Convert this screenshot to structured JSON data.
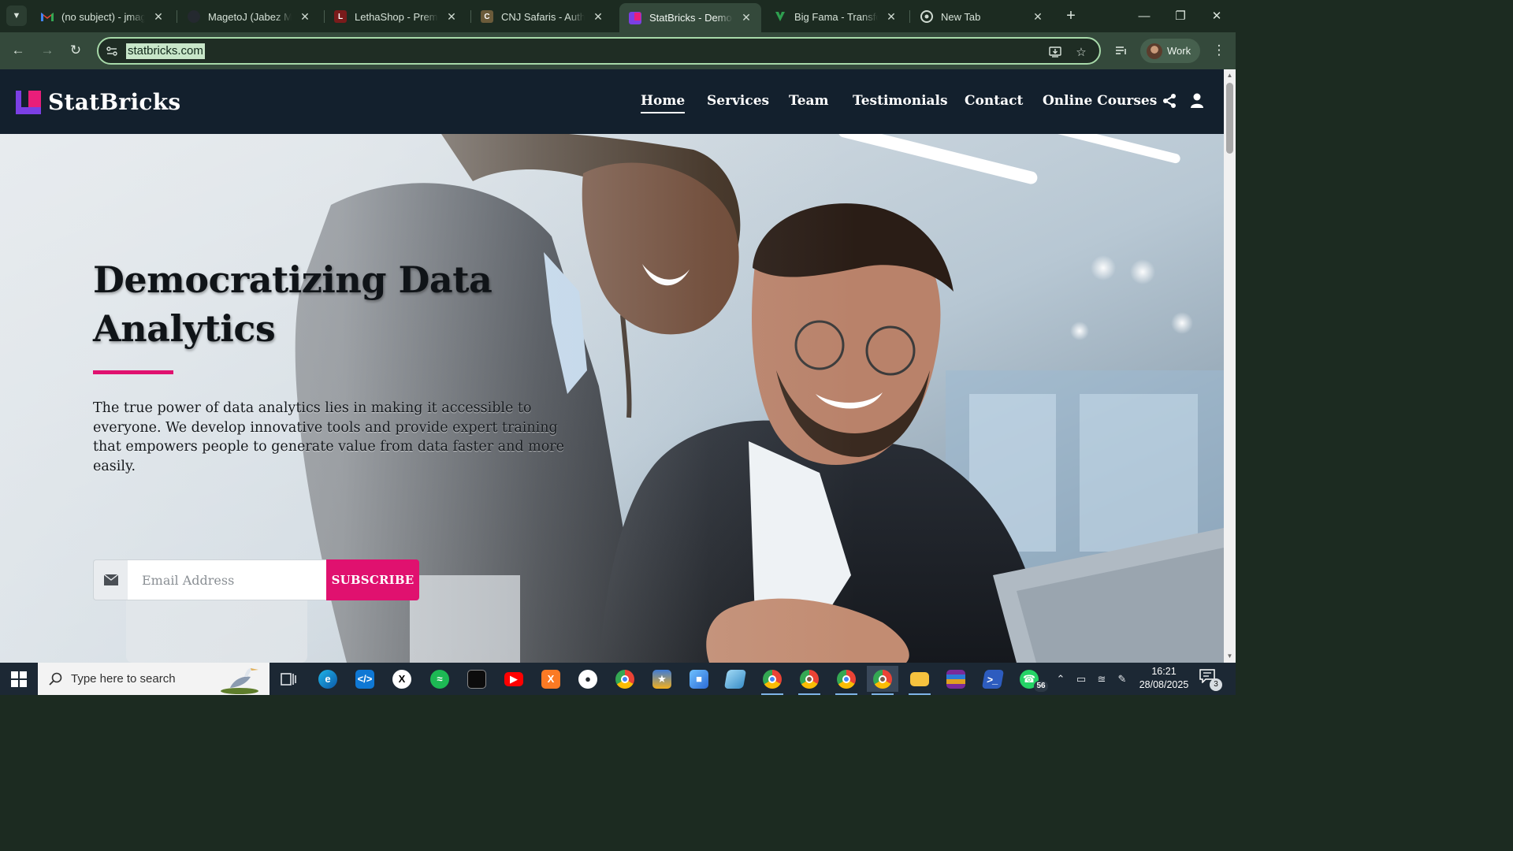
{
  "browser": {
    "tabs": [
      {
        "title": "(no subject) - jmaget",
        "favicon": "gmail-icon",
        "color": "#ea4335",
        "active": false
      },
      {
        "title": "MagetoJ (Jabez Mag",
        "favicon": "github-icon",
        "color": "#24292f",
        "active": false
      },
      {
        "title": "LethaShop - Premium",
        "favicon": "lethashop-icon",
        "color": "#7a1b1b",
        "active": false
      },
      {
        "title": "CNJ Safaris - Authent",
        "favicon": "cnj-icon",
        "color": "#6b5b3a",
        "active": false
      },
      {
        "title": "StatBricks - Democra",
        "favicon": "statbricks-icon",
        "color": "#e91e7a",
        "active": true
      },
      {
        "title": "Big Fama - Transform",
        "favicon": "bigfama-icon",
        "color": "#2e9e4f",
        "active": false
      },
      {
        "title": "New Tab",
        "favicon": "chrome-icon",
        "color": "#8a9a90",
        "active": false
      }
    ],
    "url": "statbricks.com",
    "profile_label": "Work",
    "colors": {
      "frame": "#1c2b21",
      "toolbar": "#34493b",
      "omnibox_border": "#a7d9a9"
    }
  },
  "site": {
    "brand": "StatBricks",
    "nav": [
      "Home",
      "Services",
      "Team",
      "Testimonials",
      "Contact",
      "Online Courses"
    ],
    "current_nav": "Home",
    "hero": {
      "title": "Democratizing Data Analytics",
      "text": "The true power of data analytics lies in making it accessible to everyone. We develop innovative tools and provide expert training that empowers people to generate value from data faster and more easily.",
      "email_placeholder": "Email Address",
      "subscribe_label": "SUBSCRIBE"
    },
    "colors": {
      "nav_bg": "#13202d",
      "accent": "#e0116f",
      "logo_purple": "#7b3fe4"
    }
  },
  "taskbar": {
    "search_placeholder": "Type here to search",
    "apps": [
      "task-view-icon",
      "edge-icon",
      "vscode-icon",
      "x-icon",
      "spotify-icon",
      "terminal-icon",
      "youtube-icon",
      "xampp-icon",
      "github-desktop-icon",
      "chrome-icon",
      "medal-icon",
      "cube-icon",
      "notepad-icon",
      "chrome-profile-icon",
      "chrome-profile-icon",
      "chrome-profile-icon",
      "chrome-active-icon",
      "file-explorer-icon",
      "winrar-icon",
      "powershell-icon",
      "whatsapp-icon"
    ],
    "whatsapp_badge": "56",
    "time": "16:21",
    "date": "28/08/2025",
    "notification_count": "3"
  }
}
